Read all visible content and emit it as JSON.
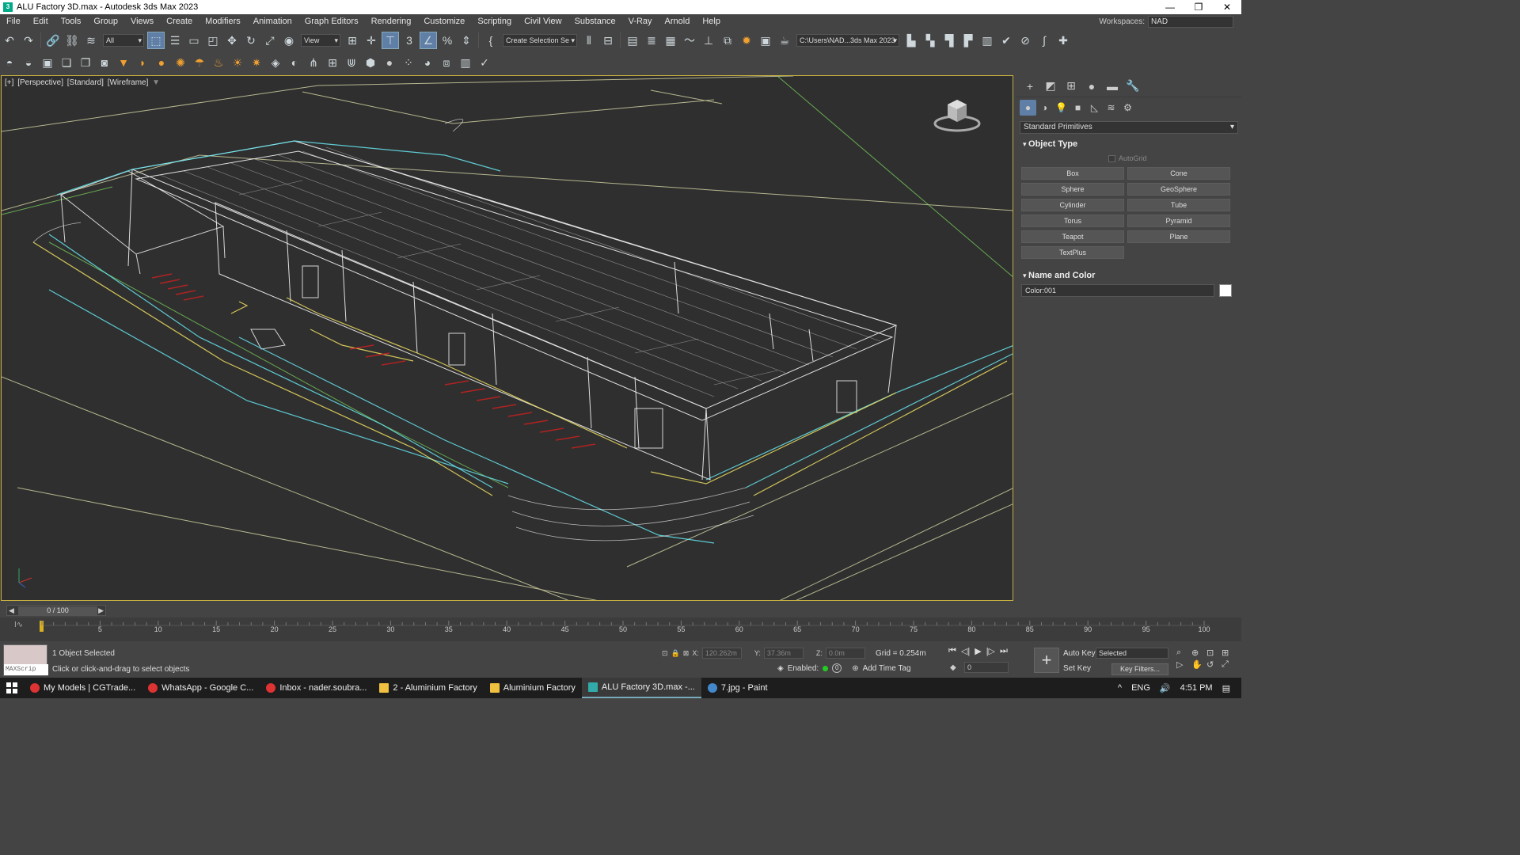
{
  "window": {
    "title": "ALU Factory 3D.max - Autodesk 3ds Max 2023",
    "controls": [
      "—",
      "❐",
      "✕"
    ]
  },
  "menu": {
    "items": [
      "File",
      "Edit",
      "Tools",
      "Group",
      "Views",
      "Create",
      "Modifiers",
      "Animation",
      "Graph Editors",
      "Rendering",
      "Customize",
      "Scripting",
      "Civil View",
      "Substance",
      "V-Ray",
      "Arnold",
      "Help"
    ],
    "workspaces_label": "Workspaces:",
    "workspaces_value": "NAD"
  },
  "toolbar": {
    "selection_filter": "All",
    "ref_coord": "View",
    "selection_set": "Create Selection Se",
    "project_path": "C:\\Users\\NAD...3ds Max 2023"
  },
  "viewport": {
    "label_plus": "[+]",
    "label_view": "[Perspective]",
    "label_shading_std": "[Standard]",
    "label_shading": "[Wireframe]"
  },
  "command_panel": {
    "category": "Standard Primitives",
    "object_type_title": "Object Type",
    "autogrid_label": "AutoGrid",
    "buttons": [
      "Box",
      "Cone",
      "Sphere",
      "GeoSphere",
      "Cylinder",
      "Tube",
      "Torus",
      "Pyramid",
      "Teapot",
      "Plane",
      "TextPlus"
    ],
    "name_color_title": "Name and Color",
    "object_name": "Color:001",
    "color_swatch": "#ffffff"
  },
  "timeline": {
    "frame_display": "0 / 100",
    "ticks": [
      "5",
      "10",
      "15",
      "20",
      "25",
      "30",
      "35",
      "40",
      "45",
      "50",
      "55",
      "60",
      "65",
      "70",
      "75",
      "80",
      "85",
      "90",
      "95",
      "100"
    ]
  },
  "status": {
    "maxscript_label": "MAXScrip",
    "selection": "1 Object Selected",
    "prompt": "Click or click-and-drag to select objects",
    "x_label": "X:",
    "x_value": "120.262m",
    "y_label": "Y:",
    "y_value": "37.36m",
    "z_label": "Z:",
    "z_value": "0.0m",
    "grid": "Grid = 0.254m",
    "enabled_label": "Enabled:",
    "add_time_tag": "Add Time Tag",
    "current_frame": "0",
    "auto_key": "Auto Key",
    "set_key": "Set Key",
    "key_mode": "Selected",
    "key_filters": "Key Filters..."
  },
  "taskbar": {
    "items": [
      {
        "label": "My Models | CGTrade...",
        "color": "#d33"
      },
      {
        "label": "WhatsApp - Google C...",
        "color": "#d33"
      },
      {
        "label": "Inbox - nader.soubra...",
        "color": "#d33"
      },
      {
        "label": "2 - Aluminium Factory",
        "color": "#f0c040"
      },
      {
        "label": "Aluminium Factory",
        "color": "#f0c040"
      },
      {
        "label": "ALU Factory 3D.max -...",
        "color": "#3aa"
      },
      {
        "label": "7.jpg - Paint",
        "color": "#48c"
      }
    ],
    "language": "ENG",
    "time": "4:51 PM"
  }
}
